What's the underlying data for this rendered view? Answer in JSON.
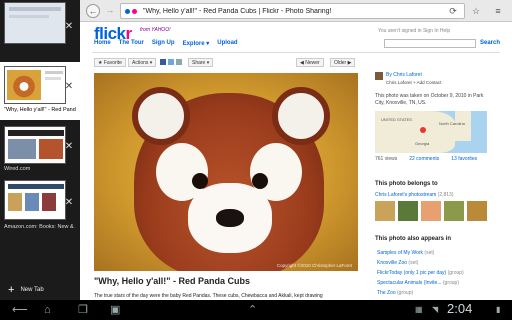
{
  "browser": {
    "url_title": "\"Why, Hello y'all!\" - Red Panda Cubs | Flickr - Photo Sharing!"
  },
  "tabs": [
    {
      "label": ""
    },
    {
      "label": "\"Why, Hello y'all!\" - Red Panda C..."
    },
    {
      "label": "Wired.com"
    },
    {
      "label": "Amazon.com: Books: New & ..."
    }
  ],
  "new_tab_label": "New Tab",
  "header": {
    "logo_main": "flick",
    "logo_r": "r",
    "yahoo": "from YAHOO!",
    "signin_text": "You aren't signed in   Sign In   Help",
    "nav": [
      "Home",
      "The Tour",
      "Sign Up",
      "Explore ▾",
      "Upload"
    ],
    "search_label": "Search"
  },
  "photo_toolbar": {
    "favorite": "★ Favorite",
    "actions": "Actions ▾",
    "share": "Share ▾",
    "newer": "◀ Newer",
    "older": "Older ▶"
  },
  "photo": {
    "credit": "Copyright ©2010 Christopher LaForet",
    "title": "\"Why, Hello y'all!\" - Red Panda Cubs",
    "description": "The true stars of the day were the baby Red Pandas. These cubs, Chewbacca and Akkali, kept drawing"
  },
  "owner": {
    "by": "By Chris Laforet",
    "sub": "Chris Laforet + Add Contact",
    "taken_line1": "This photo was taken on October 9, 2010 in Park",
    "taken_line2": "City, Knoxville, TN, US."
  },
  "map": {
    "label_us": "UNITED STATES",
    "label_nc": "North Carolina",
    "label_ga": "Georgia"
  },
  "stats": {
    "views": "761 views",
    "comments": "22 comments",
    "favorites": "13 favorites"
  },
  "belongs": {
    "heading": "This photo belongs to",
    "photostream": "Chris Laforet's photostream",
    "count": "(2,813)"
  },
  "appears": {
    "heading": "This photo also appears in",
    "items": [
      {
        "name": "Samples of My Work",
        "meta": "(set)"
      },
      {
        "name": "Knoxville Zoo",
        "meta": "(set)"
      },
      {
        "name": "FlickrToday (only 1 pic per day)",
        "meta": "(group)"
      },
      {
        "name": "Spectacular Animals (Invite...",
        "meta": "(group)"
      },
      {
        "name": "The Zoo",
        "meta": "(group)"
      }
    ]
  },
  "system": {
    "clock": "2:04"
  }
}
